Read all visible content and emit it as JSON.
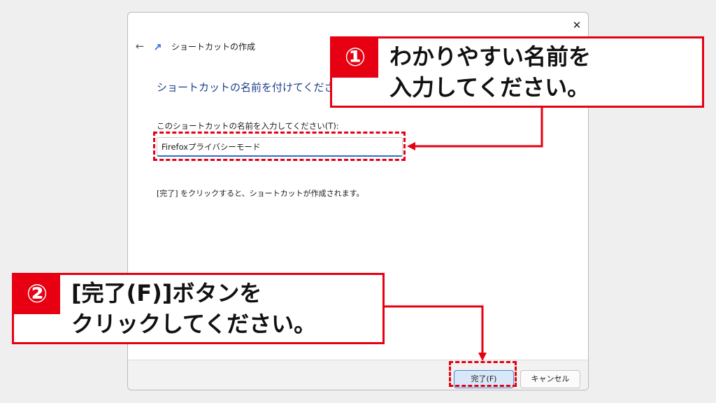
{
  "dialog": {
    "title": "ショートカットの作成",
    "close_icon": "close-icon",
    "back_icon": "back-arrow-icon",
    "heading": "ショートカットの名前を付けてください。",
    "field_label": "このショートカットの名前を入力してください(T):",
    "name_value": "Firefoxプライバシーモード",
    "hint": "[完了] をクリックすると、ショートカットが作成されます。",
    "finish_label": "完了(F)",
    "cancel_label": "キャンセル"
  },
  "annotations": {
    "step1": {
      "number": "①",
      "line1": "わかりやすい名前を",
      "line2": "入力してください。"
    },
    "step2": {
      "number": "②",
      "line1": "[完了(F)]ボタンを",
      "line2": "クリックしてください。"
    },
    "accent_color": "#e60012"
  }
}
